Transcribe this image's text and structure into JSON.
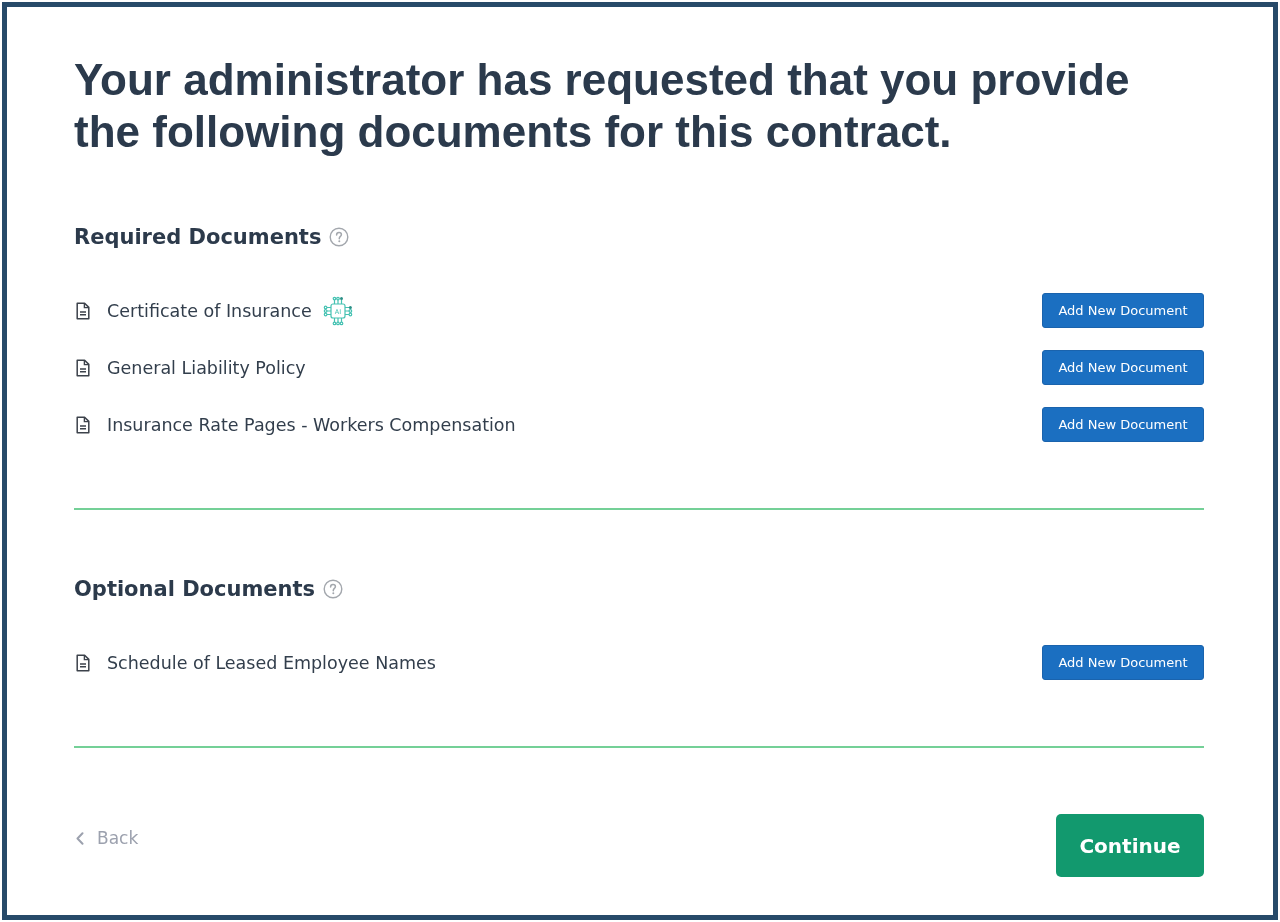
{
  "heading": "Your administrator has requested that you provide the following documents for this contract.",
  "sections": [
    {
      "title": "Required Documents",
      "documents": [
        {
          "name": "Certificate of Insurance",
          "badge": "AI",
          "button": "Add New Document"
        },
        {
          "name": "General Liability Policy",
          "button": "Add New Document"
        },
        {
          "name": "Insurance Rate Pages - Workers Compensation",
          "button": "Add New Document"
        }
      ]
    },
    {
      "title": "Optional Documents",
      "documents": [
        {
          "name": "Schedule of Leased Employee Names",
          "button": "Add New Document"
        }
      ]
    }
  ],
  "footer": {
    "back": "Back",
    "continue": "Continue"
  }
}
